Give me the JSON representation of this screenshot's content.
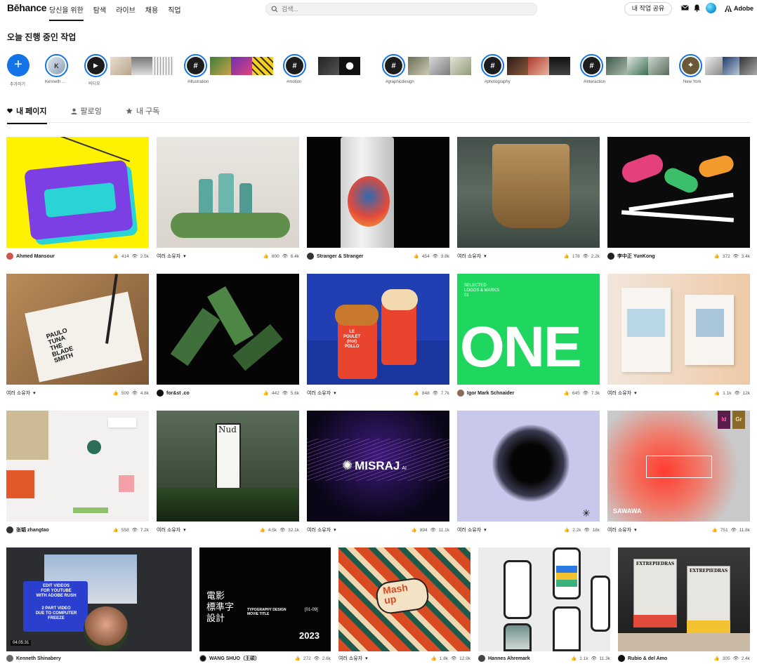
{
  "header": {
    "logo": "Bēhance",
    "nav": [
      "당신을 위한",
      "탐색",
      "라이브",
      "채용",
      "직업"
    ],
    "search_placeholder": "검색...",
    "share_label": "내 작업 공유",
    "adobe_label": "Adobe"
  },
  "today": {
    "title": "오늘 진행 중인 작업",
    "add_label": "추가하기",
    "stories": [
      {
        "label": "Kenneth ...",
        "glyph": "K"
      },
      {
        "label": "비디오",
        "glyph": "▶"
      },
      {
        "label": "#illustration",
        "glyph": "#"
      },
      {
        "label": "#motion",
        "glyph": "#"
      },
      {
        "label": "#graphicdesign",
        "glyph": "#"
      },
      {
        "label": "#photography",
        "glyph": "#"
      },
      {
        "label": "#interaction",
        "glyph": "#"
      },
      {
        "label": "New York",
        "glyph": "⌖"
      }
    ]
  },
  "tabs": [
    "내 페이지",
    "팔로잉",
    "내 구독"
  ],
  "projects": [
    {
      "owner": "Ahmed Mansour",
      "likes": "414",
      "views": "2.5k",
      "multi": false
    },
    {
      "owner": "여러 소유자",
      "likes": "800",
      "views": "6.4k",
      "multi": true
    },
    {
      "owner": "Stranger & Stranger",
      "likes": "454",
      "views": "3.8k",
      "multi": false
    },
    {
      "owner": "여러 소유자",
      "likes": "178",
      "views": "2.2k",
      "multi": true
    },
    {
      "owner": "李中正 YunKong",
      "likes": "372",
      "views": "3.4k",
      "multi": false
    },
    {
      "owner": "여러 소유자",
      "likes": "509",
      "views": "4.8k",
      "multi": true
    },
    {
      "owner": "for&st .co",
      "likes": "442",
      "views": "5.6k",
      "multi": false
    },
    {
      "owner": "여러 소유자",
      "likes": "848",
      "views": "7.7k",
      "multi": true
    },
    {
      "owner": "Igor Mark Schnaider",
      "likes": "645",
      "views": "7.3k",
      "multi": false
    },
    {
      "owner": "여러 소유자",
      "likes": "1.1k",
      "views": "12k",
      "multi": true
    },
    {
      "owner": "张韬 zhangtao",
      "likes": "558",
      "views": "7.2k",
      "multi": false
    },
    {
      "owner": "여러 소유자",
      "likes": "4.5k",
      "views": "32.1k",
      "multi": true
    },
    {
      "owner": "여러 소유자",
      "likes": "894",
      "views": "11.1k",
      "multi": true
    },
    {
      "owner": "여러 소유자",
      "likes": "2.2k",
      "views": "18k",
      "multi": true
    },
    {
      "owner": "여러 소유자",
      "likes": "751",
      "views": "11.8k",
      "multi": true
    },
    {
      "owner": "Kenneth Shinabery",
      "likes": "",
      "views": "",
      "multi": false
    },
    {
      "owner": "WANG SHUO（王硕）",
      "likes": "272",
      "views": "2.6k",
      "multi": false
    },
    {
      "owner": "여러 소유자",
      "likes": "1.8k",
      "views": "12.9k",
      "multi": true
    },
    {
      "owner": "Hannes Ahremark",
      "likes": "1.1k",
      "views": "11.3k",
      "multi": false
    },
    {
      "owner": "Rubio & del Amo",
      "likes": "305",
      "views": "2.4k",
      "multi": false
    }
  ],
  "thumb_text": {
    "p4_title": "SELECTED\nLOGOS & MARKS\n01",
    "p4_big": "ONE",
    "p8_brand": "MISRAJ",
    "p8_ai": "AI",
    "p10_label": "SAWAWA",
    "p10_id": "Id",
    "p10_gr": "Gr",
    "p11_top": "EDIT VIDEOS\nFOR YOUTUBE\nWITH ADOBE RUSH",
    "p11_bottom": "2 PART VIDEO\nDUE TO COMPUTER\nFREEZE",
    "p11_time": "04:05:31",
    "p12_cjk": "電影\n標準字\n設計",
    "p12_title": "TYPOGRAPHY DESIGN\nMOVIE TITLE",
    "p12_index": "[01-09]",
    "p12_year": "2023",
    "p7_tag": "LE\nPOULET\n(Hot)\nPOLLO",
    "p5_tag": "PAULO\nTUNA\nTHE\nBLADE\nSMITH",
    "p19_brand": "EXTREPIEDRAS",
    "p13_brand": "Nud",
    "p17_title": "Mash\nup"
  },
  "colors": {
    "accent": "#1473e6",
    "text": "#191919"
  }
}
